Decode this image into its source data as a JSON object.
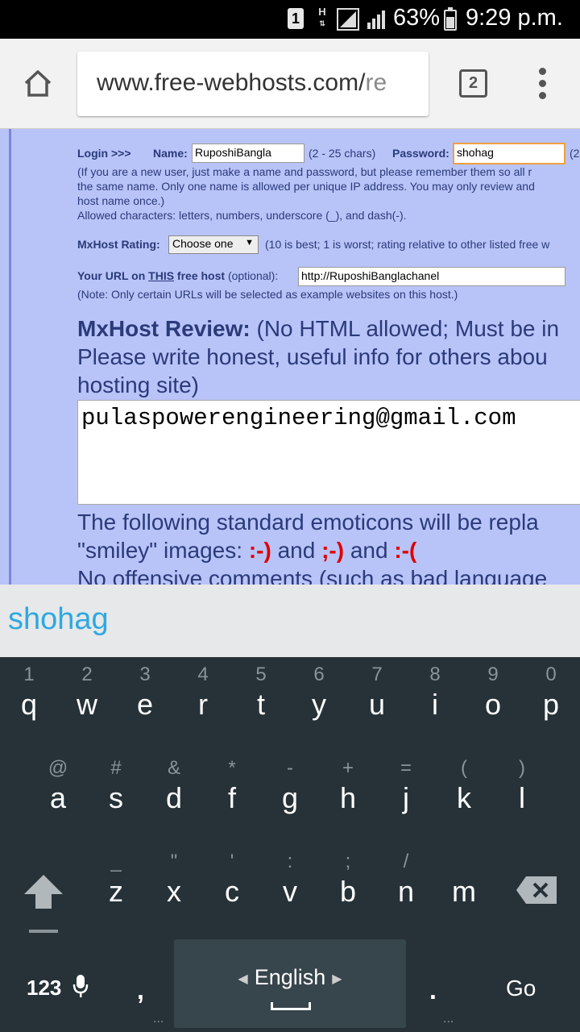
{
  "status_bar": {
    "sim": "1",
    "network_h": "H",
    "battery_percent": "63%",
    "battery_level": 0.63,
    "time": "9:29 p.m."
  },
  "browser": {
    "url_main": "www.free-webhosts.com/",
    "url_dim": "re",
    "tab_count": "2",
    "icons": [
      "home-icon",
      "tabs-icon",
      "overflow-menu-icon"
    ]
  },
  "page": {
    "login_label": "Login >>>",
    "name_label": "Name:",
    "name_value": "RuposhiBangla",
    "name_hint": "(2 - 25 chars)",
    "password_label": "Password:",
    "password_value": "shohag",
    "password_hint": "(2",
    "note_line1": "(If you are a new user, just make a name and password, but please remember them so all r",
    "note_line2": "the same name. Only one name is allowed per unique IP address. You may only review and",
    "note_line3": "host name once.)",
    "note_line4": "Allowed characters: letters, numbers, underscore (_), and dash(-).",
    "rating_label": "MxHost Rating:",
    "rating_select": "Choose one",
    "rating_hint": "(10 is best; 1 is worst; rating relative to other listed free w",
    "url_label_pre": "Your URL on ",
    "url_label_this": "THIS",
    "url_label_post": " free host",
    "url_optional": " (optional):",
    "url_value": "http://RuposhiBanglachanel",
    "url_note": "(Note: Only certain URLs will be selected as example websites on this host.)",
    "review_title": "MxHost Review:",
    "review_line1_rest": "  (No HTML allowed; Must be in",
    "review_line2": "Please write honest, useful info for others abou",
    "review_line3": "hosting site)",
    "review_text": "pulaspowerengineering@gmail.com",
    "emo_line1": "The following standard emoticons will be repla",
    "emo_line2_pre": "\"smiley\" images: ",
    "emo_smile": ":-)",
    "emo_and1": " and ",
    "emo_wink": ";-)",
    "emo_and2": " and ",
    "emo_sad": ":-(",
    "emo_line3": "No offensive comments (such as bad language"
  },
  "keyboard": {
    "suggestion": "shohag",
    "row1": [
      {
        "hint": "1",
        "key": "q"
      },
      {
        "hint": "2",
        "key": "w"
      },
      {
        "hint": "3",
        "key": "e"
      },
      {
        "hint": "4",
        "key": "r"
      },
      {
        "hint": "5",
        "key": "t"
      },
      {
        "hint": "6",
        "key": "y"
      },
      {
        "hint": "7",
        "key": "u"
      },
      {
        "hint": "8",
        "key": "i"
      },
      {
        "hint": "9",
        "key": "o"
      },
      {
        "hint": "0",
        "key": "p"
      }
    ],
    "row2": [
      {
        "hint": "@",
        "key": "a"
      },
      {
        "hint": "#",
        "key": "s"
      },
      {
        "hint": "&",
        "key": "d"
      },
      {
        "hint": "*",
        "key": "f"
      },
      {
        "hint": "-",
        "key": "g"
      },
      {
        "hint": "+",
        "key": "h"
      },
      {
        "hint": "=",
        "key": "j"
      },
      {
        "hint": "(",
        "key": "k"
      },
      {
        "hint": ")",
        "key": "l"
      }
    ],
    "row3": [
      {
        "hint": "_",
        "key": "z"
      },
      {
        "hint": "\"",
        "key": "x"
      },
      {
        "hint": "'",
        "key": "c"
      },
      {
        "hint": ":",
        "key": "v"
      },
      {
        "hint": ";",
        "key": "b"
      },
      {
        "hint": "/",
        "key": "n"
      },
      {
        "hint": "",
        "key": "m"
      }
    ],
    "symbols_label": "123",
    "comma": ",",
    "space_label": "English",
    "period": ".",
    "go_label": "Go"
  }
}
